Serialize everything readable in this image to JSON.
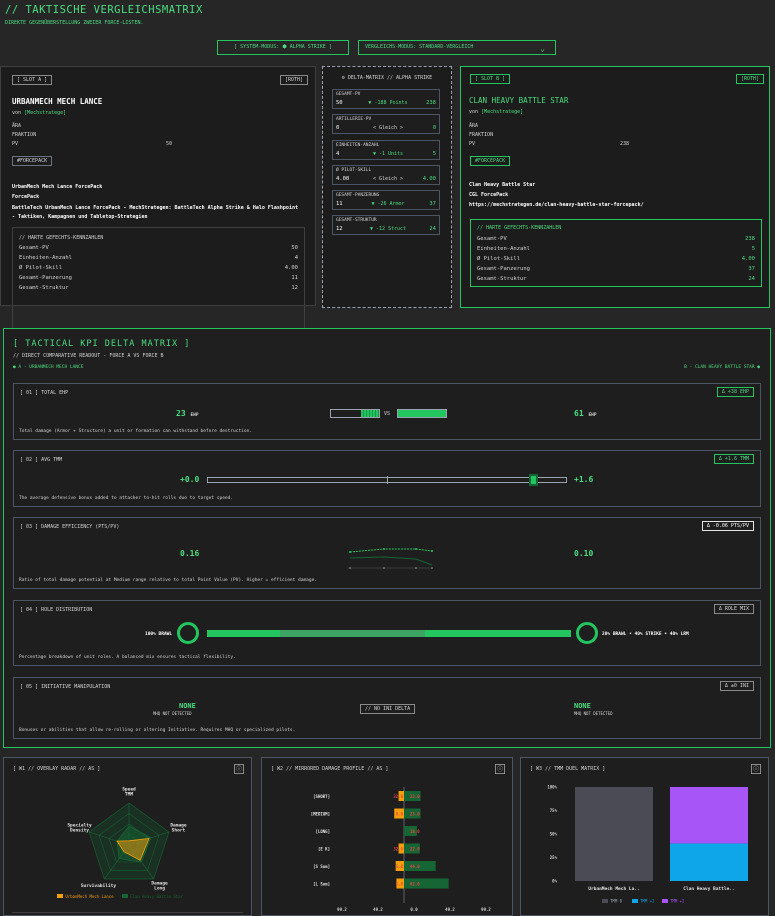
{
  "header": {
    "title": "// TAKTISCHE VERGLEICHSMATRIX",
    "subtitle": "DIREKTE GEGENÜBERSTELLUNG ZWEIER FORCE-LISTEN.",
    "system_mode": "[ SYSTEM-MODUS: ⬢ ALPHA STRIKE ]",
    "compare_mode": "VERGLEICHS-MODUS:  STANDARD-VERGLEICH"
  },
  "slot_a": {
    "slot_label": "[ SLOT A ]",
    "pill": "[ROTH]",
    "title": "URBANMECH MECH LANCE",
    "by_prefix": "von",
    "by": "[Mechstratege]",
    "meta": [
      {
        "k": "ÄRA",
        "v": ""
      },
      {
        "k": "FRAKTION",
        "v": ""
      },
      {
        "k": "PV",
        "v": "50"
      }
    ],
    "badge": "#FORCEPACK",
    "desc1": "UrbanMech Mech Lance ForcePack",
    "desc2": "ForcePack",
    "desc3": "BattleTech UrbanMech Lance ForcePack - MechStrategen: BattleTech Alpha Strike & Halo Flashpoint - Taktiken, Kampagnen und Tabletop-Strategien",
    "stats_title": "// HARTE GEFECHTS-KENNZAHLEN",
    "stats": [
      {
        "k": "Gesamt-PV",
        "v": "50"
      },
      {
        "k": "Einheiten-Anzahl",
        "v": "4"
      },
      {
        "k": "Ø Pilot-Skill",
        "v": "4.00"
      },
      {
        "k": "Gesamt-Panzerung",
        "v": "11"
      },
      {
        "k": "Gesamt-Struktur",
        "v": "12"
      }
    ]
  },
  "delta_matrix": {
    "title": "⚙ DELTA-MATRIX // ALPHA STRIKE",
    "rows": [
      {
        "k": "GESAMT-PV",
        "a": "50",
        "d": "▼ -188 Points",
        "b": "238"
      },
      {
        "k": "ARTILLERIE-PV",
        "a": "0",
        "d": "< Gleich >",
        "b": "0"
      },
      {
        "k": "EINHEITEN-ANZAHL",
        "a": "4",
        "d": "▼ -1 Units",
        "b": "5"
      },
      {
        "k": "Ø PILOT-SKILL",
        "a": "4.00",
        "d": "< Gleich >",
        "b": "4.00"
      },
      {
        "k": "GESAMT-PANZERUNG",
        "a": "11",
        "d": "▼ -26 Armor",
        "b": "37"
      },
      {
        "k": "GESAMT-STRUKTUR",
        "a": "12",
        "d": "▼ -12 Struct",
        "b": "24"
      }
    ]
  },
  "slot_b": {
    "slot_label": "[ SLOT B ]",
    "pill": "[ROTH]",
    "title": "CLAN HEAVY BATTLE STAR",
    "by_prefix": "von",
    "by": "[Mechstratege]",
    "meta": [
      {
        "k": "ÄRA",
        "v": ""
      },
      {
        "k": "FRAKTION",
        "v": ""
      },
      {
        "k": "PV",
        "v": "238"
      }
    ],
    "badge": "#FORCEPACK",
    "desc1": "Clan Heavy Battle Star",
    "desc2": "CGL ForcePack",
    "desc3": "https://mechstrategen.de/clan-heavy-battle-star-forcepack/",
    "stats_title": "// HARTE GEFECHTS-KENNZAHLEN",
    "stats": [
      {
        "k": "Gesamt-PV",
        "v": "238"
      },
      {
        "k": "Einheiten-Anzahl",
        "v": "5"
      },
      {
        "k": "Ø Pilot-Skill",
        "v": "4.00"
      },
      {
        "k": "Gesamt-Panzerung",
        "v": "37"
      },
      {
        "k": "Gesamt-Struktur",
        "v": "24"
      }
    ]
  },
  "kpi": {
    "title": "[ TACTICAL KPI DELTA MATRIX ]",
    "subtitle": "// DIRECT COMPARATIVE READOUT - FORCE A VS FORCE B",
    "force_a": "● A - URBANMECH MECH LANCE",
    "force_b": "B - CLAN HEAVY BATTLE STAR ●",
    "ehp": {
      "title": "[ 01 ] TOTAL EHP",
      "badge": "Δ +38 EHP",
      "a_value": "23",
      "a_unit": "EHP",
      "vs": "VS",
      "b_value": "61",
      "b_unit": "EHP",
      "a_fill": 0.38,
      "b_fill": 1.0,
      "desc": "Total damage (Armor + Structure) a unit or formation can withstand before destruction."
    },
    "tmm": {
      "title": "[ 02 ] AVG TMM",
      "badge": "Δ +1.6 TMM",
      "a_value": "+0.0",
      "b_value": "+1.6",
      "b_marker": 0.91,
      "desc": "The average defensive bonus added to attacker to-hit rolls due to target speed."
    },
    "efficiency": {
      "title": "[ 03 ] DAMAGE EFFICIENCY (PTS/PV)",
      "badge": "Δ -0.06 PTS/PV",
      "a_value": "0.16",
      "b_value": "0.10",
      "desc": "Ratio of total damage potential at Medium range relative to total Point Value (PV). Higher = efficient damage."
    },
    "roles": {
      "title": "[ 04 ] ROLE DISTRIBUTION",
      "badge": "Δ ROLE MIX",
      "a_value": "100% BRAWL",
      "b_value": "20% BRAWL • 40% STRIKE • 40% LRM",
      "segments": [
        0.2,
        0.4,
        0.4
      ],
      "desc": "Percentage breakdown of unit roles. A balanced mix ensures tactical flexibility."
    },
    "initiative": {
      "title": "[ 05 ] INITIATIVE MANIPULATION",
      "badge": "Δ ±0 INI",
      "a_value": "NONE",
      "a_sub": "MHQ NOT DETECTED",
      "mid": "// NO INI DELTA",
      "b_value": "NONE",
      "b_sub": "MHQ NOT DETECTED",
      "desc": "Bonuses or abilities that allow re-rolling or altering Initiative. Requires MHQ or specialized pilots."
    }
  },
  "panels": {
    "radar_title": "[ W1 // OVERLAY RADAR // AS ]",
    "damage_title": "[ W2 // MIRRORED DAMAGE PROFILE // AS ]",
    "tmm_title": "[ W3 // TMM DUEL MATRIX ]",
    "info_icon": "ⓘ"
  },
  "colors": {
    "accent": "#22c55e",
    "force_a": "#f59e0b",
    "force_b": "#166534",
    "tmm0": "#4b4b55",
    "tmm1": "#0ea5e9",
    "tmm2": "#a855f7"
  },
  "chart_data": [
    {
      "type": "radar",
      "axes": [
        "Speed TMM",
        "Damage Short",
        "Damage Long",
        "Survivability",
        "Specialty Density"
      ],
      "series": [
        {
          "name": "UrbanMech Mech Lance",
          "values": [
            0.1,
            0.5,
            0.45,
            0.2,
            0.3
          ]
        },
        {
          "name": "Clan Heavy Battle Star",
          "values": [
            0.45,
            0.55,
            0.5,
            0.4,
            0.3
          ]
        }
      ]
    },
    {
      "type": "bar",
      "categories": [
        "[SHORT]",
        "[MEDIUM]",
        "[LONG]",
        "[E K]",
        "[S Sum]",
        "[L Sum]"
      ],
      "series": [
        {
          "name": "UrbanMech Mech Lance",
          "values": [
            -2.0,
            -8.0,
            0,
            -2.0,
            -6.0,
            -5.0
          ]
        },
        {
          "name": "Clan Heavy Battle Star",
          "values": [
            23.0,
            23.0,
            18.0,
            22.0,
            44.0,
            62.0
          ]
        }
      ],
      "labels_a": [
        "32.0",
        "8.0",
        "",
        "32.0",
        "5.0",
        "5.0"
      ],
      "labels_b": [
        "23.0",
        "23.0",
        "18.0",
        "22.0",
        "44.0",
        "62.0"
      ],
      "x_ticks": [
        "99.2",
        "49.2",
        "0.0",
        "49.2",
        "99.2"
      ]
    },
    {
      "type": "bar",
      "stacked": true,
      "categories": [
        "UrbanMech Mech La..",
        "Clan Heavy Battle.."
      ],
      "series": [
        {
          "name": "TMM 0",
          "values": [
            100,
            0
          ]
        },
        {
          "name": "TMM +1",
          "values": [
            0,
            40
          ]
        },
        {
          "name": "TMM +2",
          "values": [
            0,
            60
          ]
        }
      ],
      "y_ticks": [
        "100%",
        "75%",
        "50%",
        "25%",
        "0%"
      ]
    }
  ]
}
